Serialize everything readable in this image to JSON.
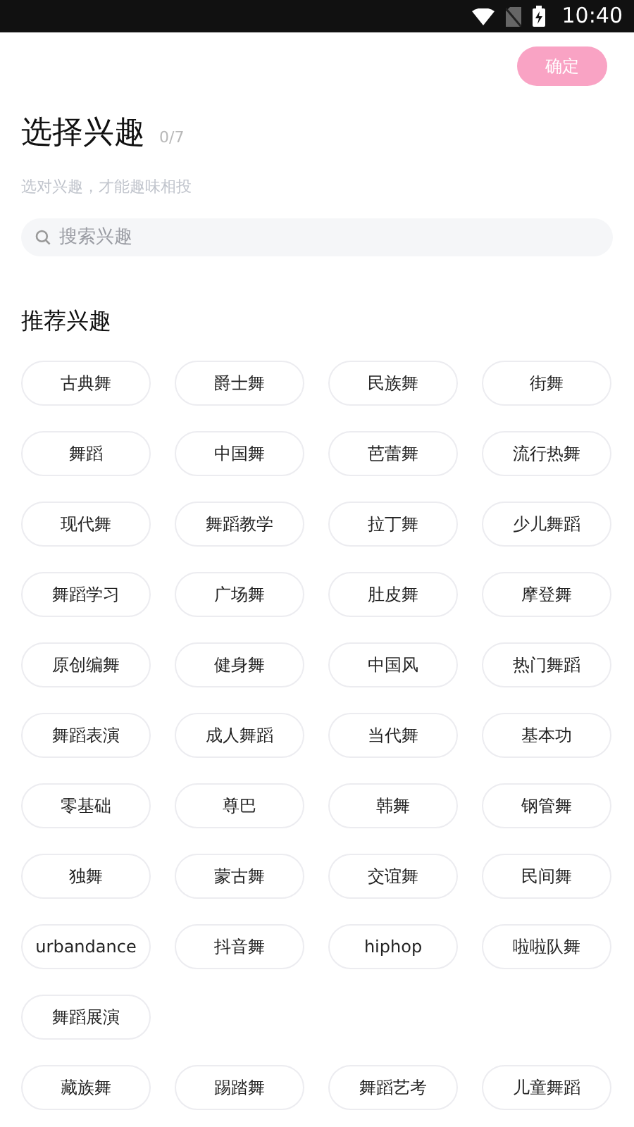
{
  "status_bar": {
    "time": "10:40"
  },
  "confirm_button": {
    "label": "确定",
    "disabled": true
  },
  "title": "选择兴趣",
  "count": "0/7",
  "subtitle": "选对兴趣，才能趣味相投",
  "search": {
    "placeholder": "搜索兴趣"
  },
  "section_title": "推荐兴趣",
  "tags": [
    {
      "label": "古典舞",
      "selected": false
    },
    {
      "label": "爵士舞",
      "selected": false
    },
    {
      "label": "民族舞",
      "selected": false
    },
    {
      "label": "街舞",
      "selected": false
    },
    {
      "label": "舞蹈",
      "selected": false
    },
    {
      "label": "中国舞",
      "selected": false
    },
    {
      "label": "芭蕾舞",
      "selected": false
    },
    {
      "label": "流行热舞",
      "selected": false
    },
    {
      "label": "现代舞",
      "selected": false
    },
    {
      "label": "舞蹈教学",
      "selected": false
    },
    {
      "label": "拉丁舞",
      "selected": false
    },
    {
      "label": "少儿舞蹈",
      "selected": false
    },
    {
      "label": "舞蹈学习",
      "selected": false
    },
    {
      "label": "广场舞",
      "selected": false
    },
    {
      "label": "肚皮舞",
      "selected": false
    },
    {
      "label": "摩登舞",
      "selected": false
    },
    {
      "label": "原创编舞",
      "selected": false
    },
    {
      "label": "健身舞",
      "selected": false
    },
    {
      "label": "中国风",
      "selected": false
    },
    {
      "label": "热门舞蹈",
      "selected": false
    },
    {
      "label": "舞蹈表演",
      "selected": false
    },
    {
      "label": "成人舞蹈",
      "selected": false
    },
    {
      "label": "当代舞",
      "selected": false
    },
    {
      "label": "基本功",
      "selected": false
    },
    {
      "label": "零基础",
      "selected": false
    },
    {
      "label": "尊巴",
      "selected": false
    },
    {
      "label": "韩舞",
      "selected": false
    },
    {
      "label": "钢管舞",
      "selected": false
    },
    {
      "label": "独舞",
      "selected": false
    },
    {
      "label": "蒙古舞",
      "selected": false
    },
    {
      "label": "交谊舞",
      "selected": false
    },
    {
      "label": "民间舞",
      "selected": false
    },
    {
      "label": "urbandance",
      "selected": false
    },
    {
      "label": "抖音舞",
      "selected": false
    },
    {
      "label": "hiphop",
      "selected": false
    },
    {
      "label": "啦啦队舞",
      "selected": false
    },
    {
      "label": "舞蹈展演",
      "selected": false
    },
    {
      "label": "藏族舞",
      "selected": false
    },
    {
      "label": "踢踏舞",
      "selected": false
    },
    {
      "label": "舞蹈艺考",
      "selected": false
    },
    {
      "label": "儿童舞蹈",
      "selected": false
    }
  ]
}
